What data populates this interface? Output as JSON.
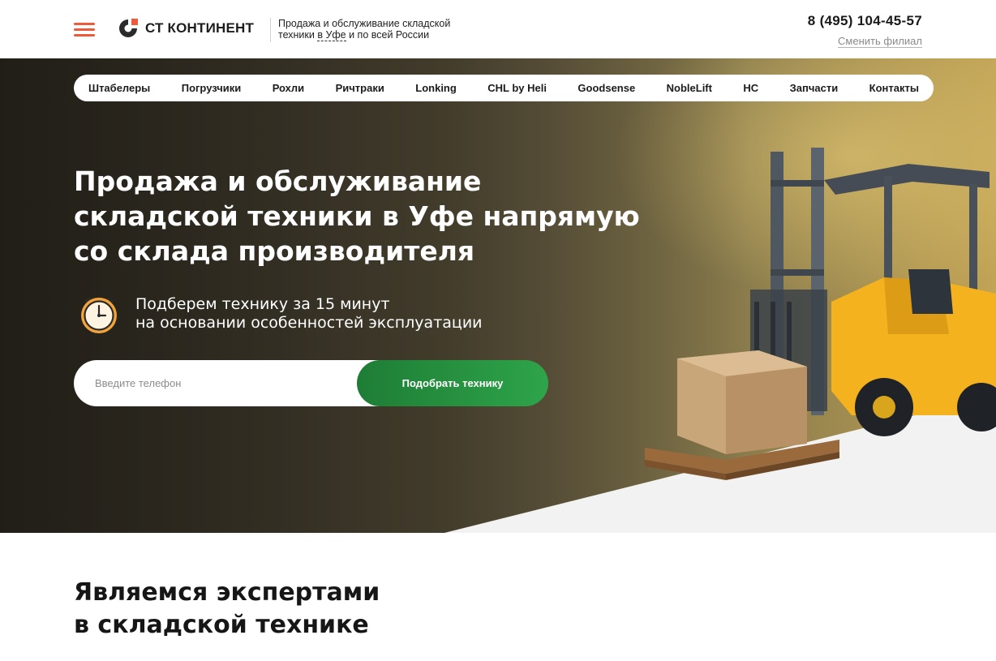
{
  "header": {
    "menu_icon": "hamburger-menu-icon",
    "logo_text": "СТ КОНТИНЕНТ",
    "tagline_line1": "Продажа и обслуживание складской",
    "tagline_prefix": "техники ",
    "tagline_city": "в Уфе",
    "tagline_suffix": " и по всей России",
    "phone": "8 (495) 104-45-57",
    "change_branch": "Сменить филиал",
    "colors": {
      "accent": "#ee5a3a"
    }
  },
  "nav": {
    "items": [
      {
        "label": "Штабелеры"
      },
      {
        "label": "Погрузчики"
      },
      {
        "label": "Рохли"
      },
      {
        "label": "Ричтраки"
      },
      {
        "label": "Lonking"
      },
      {
        "label": "CHL by Heli"
      },
      {
        "label": "Goodsense"
      },
      {
        "label": "NobleLift"
      },
      {
        "label": "HC"
      },
      {
        "label": "Запчасти"
      },
      {
        "label": "Контакты"
      }
    ]
  },
  "hero": {
    "title_line1": "Продажа и обслуживание",
    "title_line2": "складской техники в Уфе напрямую",
    "title_line3": "со склада производителя",
    "perk_icon": "alarm-clock-icon",
    "perk_line1": "Подберем технику за 15 минут",
    "perk_line2": "на основании особенностей эксплуатации",
    "phone_placeholder": "Введите телефон",
    "phone_value": "",
    "submit_label": "Подобрать технику",
    "image": "forklift-with-box-illustration",
    "colors": {
      "button": "#28993f"
    }
  },
  "experts": {
    "title_line1": "Являемся экспертами",
    "title_line2": "в складской технике"
  }
}
